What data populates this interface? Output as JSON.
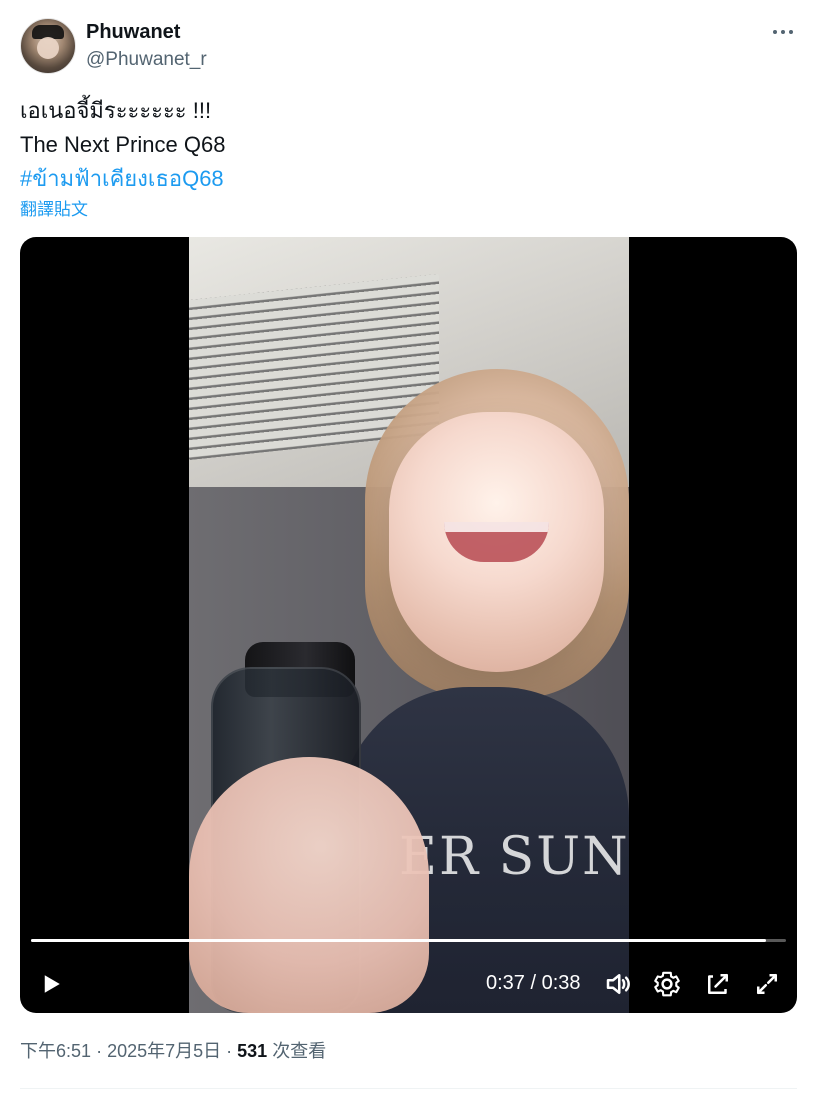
{
  "post": {
    "author": {
      "display_name": "Phuwanet",
      "handle": "@Phuwanet_r"
    },
    "text_lines": [
      "เอเนอจี้มีระะะะะะ  !!!",
      "The Next Prince Q68"
    ],
    "hashtag": "#ข้ามฟ้าเคียงเธอQ68",
    "translate_label": "翻譯貼文",
    "media": {
      "type": "video",
      "shirt_text": "ER SUN",
      "playback": {
        "current_time": "0:37",
        "duration": "0:38",
        "progress_fraction": 0.974
      },
      "controls": {
        "play_icon": "play-icon",
        "volume_icon": "volume-icon",
        "settings_icon": "settings-icon",
        "pip_icon": "picture-in-picture-icon",
        "fullscreen_icon": "fullscreen-icon"
      }
    },
    "meta": {
      "time": "下午6:51",
      "date": "2025年7月5日",
      "views_count": "531",
      "views_label": "次查看"
    }
  }
}
